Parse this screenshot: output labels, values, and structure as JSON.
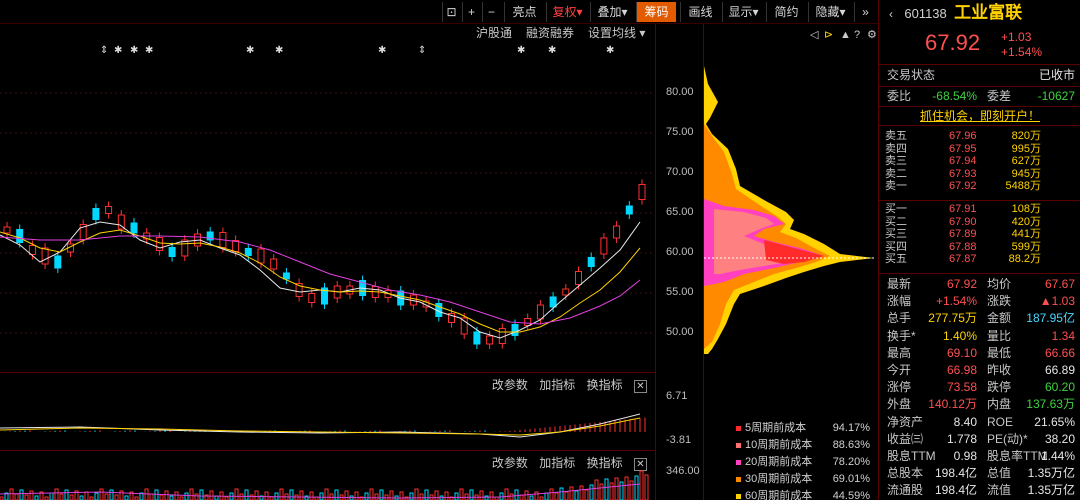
{
  "toolbar": {
    "icons": [
      "lock-icon",
      "plus-icon",
      "minus-icon"
    ],
    "buttons": [
      "亮点",
      "复权",
      "叠加",
      "筹码",
      "画线",
      "显示",
      "简约",
      "隐藏"
    ],
    "active": "筹码",
    "more": "◂▸"
  },
  "subbar": {
    "items": [
      "沪股通",
      "融资融券",
      "设置均线"
    ]
  },
  "y_axis": {
    "labels": [
      "80.00",
      "75.00",
      "70.00",
      "65.00",
      "60.00",
      "55.00",
      "50.00"
    ]
  },
  "ind1": {
    "btn1": "改参数",
    "btn2": "加指标",
    "btn3": "换指标",
    "close": "✕",
    "top": "6.71",
    "bottom": "-3.81"
  },
  "ind2": {
    "btn1": "改参数",
    "btn2": "加指标",
    "btn3": "换指标",
    "close": "✕",
    "top": "346.00"
  },
  "cost_legend": [
    {
      "label": "5周期前成本",
      "pct": "94.17%",
      "color": "#ff2a2a"
    },
    {
      "label": "10周期前成本",
      "pct": "88.63%",
      "color": "#ff7070"
    },
    {
      "label": "20周期前成本",
      "pct": "78.20%",
      "color": "#ff40c0"
    },
    {
      "label": "30周期前成本",
      "pct": "69.01%",
      "color": "#ff8a00"
    },
    {
      "label": "60周期前成本",
      "pct": "44.59%",
      "color": "#ffd200"
    }
  ],
  "quote": {
    "code": "601138",
    "name": "工业富联",
    "price": "67.92",
    "change": "+1.03",
    "change_pct": "+1.54%",
    "status_label": "交易状态",
    "status": "已收市",
    "wb_label": "委比",
    "wb": "-68.54%",
    "wc_label": "委差",
    "wc": "-10627",
    "promo": "抓住机会，即刻开户！"
  },
  "sell": [
    {
      "label": "卖五",
      "price": "67.96",
      "vol": "820万"
    },
    {
      "label": "卖四",
      "price": "67.95",
      "vol": "995万"
    },
    {
      "label": "卖三",
      "price": "67.94",
      "vol": "627万"
    },
    {
      "label": "卖二",
      "price": "67.93",
      "vol": "945万"
    },
    {
      "label": "卖一",
      "price": "67.92",
      "vol": "5488万"
    }
  ],
  "buy": [
    {
      "label": "买一",
      "price": "67.91",
      "vol": "108万"
    },
    {
      "label": "买二",
      "price": "67.90",
      "vol": "420万"
    },
    {
      "label": "买三",
      "price": "67.89",
      "vol": "441万"
    },
    {
      "label": "买四",
      "price": "67.88",
      "vol": "599万"
    },
    {
      "label": "买五",
      "price": "67.87",
      "vol": "88.2万"
    }
  ],
  "stats": [
    {
      "k": "最新",
      "v": "67.92",
      "vc": "red",
      "k2": "均价",
      "v2": "67.67",
      "v2c": "red"
    },
    {
      "k": "涨幅",
      "v": "+1.54%",
      "vc": "red",
      "k2": "涨跌",
      "v2": "▲1.03",
      "v2c": "red"
    },
    {
      "k": "总手",
      "v": "277.75万",
      "vc": "yellow",
      "k2": "金额",
      "v2": "187.95亿",
      "v2c": "cyan"
    },
    {
      "k": "换手*",
      "v": "1.40%",
      "vc": "yellow",
      "k2": "量比",
      "v2": "1.34",
      "v2c": "red"
    },
    {
      "k": "最高",
      "v": "69.10",
      "vc": "red",
      "k2": "最低",
      "v2": "66.66",
      "v2c": "red"
    },
    {
      "k": "今开",
      "v": "66.98",
      "vc": "red",
      "k2": "昨收",
      "v2": "66.89",
      "v2c": "white"
    },
    {
      "k": "涨停",
      "v": "73.58",
      "vc": "red",
      "k2": "跌停",
      "v2": "60.20",
      "v2c": "green"
    },
    {
      "k": "外盘",
      "v": "140.12万",
      "vc": "red",
      "k2": "内盘",
      "v2": "137.63万",
      "v2c": "green"
    },
    {
      "k": "净资产",
      "v": "8.40",
      "vc": "white",
      "k2": "ROE",
      "v2": "21.65%",
      "v2c": "white"
    },
    {
      "k": "收益㈢",
      "v": "1.778",
      "vc": "white",
      "k2": "PE(动)*",
      "v2": "38.20",
      "v2c": "white"
    },
    {
      "k": "股息TTM",
      "v": "0.98",
      "vc": "white",
      "k2": "股息率TTM",
      "v2": "1.44%",
      "v2c": "white"
    },
    {
      "k": "总股本",
      "v": "198.4亿",
      "vc": "white",
      "k2": "总值",
      "v2": "1.35万亿",
      "v2c": "white"
    },
    {
      "k": "流通股",
      "v": "198.4亿",
      "vc": "white",
      "k2": "流值",
      "v2": "1.35万亿",
      "v2c": "white"
    }
  ]
}
